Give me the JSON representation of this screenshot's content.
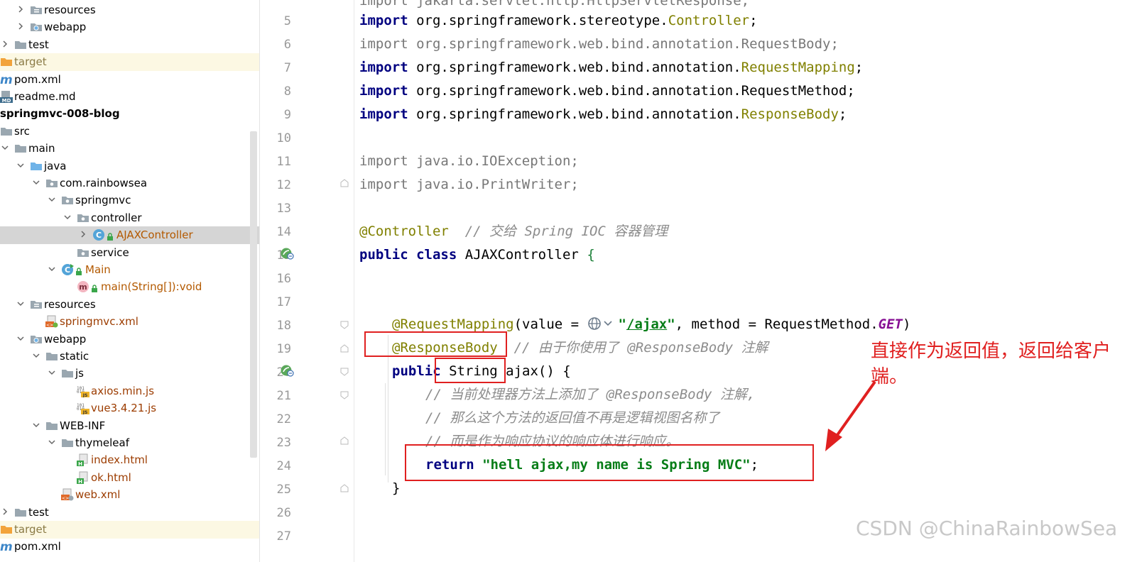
{
  "tree": {
    "items": [
      {
        "label": "resources",
        "indent": 1,
        "arrow": "right",
        "icon": "resources-folder-icon",
        "style": ""
      },
      {
        "label": "webapp",
        "indent": 1,
        "arrow": "right",
        "icon": "web-folder-icon",
        "style": ""
      },
      {
        "label": "test",
        "indent": 0,
        "arrow": "right",
        "icon": "folder-icon",
        "style": ""
      },
      {
        "label": "target",
        "indent": 0,
        "arrow": "",
        "icon": "orange-folder-icon",
        "style": "muted",
        "row": "hl-yellow"
      },
      {
        "label": "pom.xml",
        "indent": 0,
        "arrow": "",
        "icon": "maven-icon",
        "style": ""
      },
      {
        "label": "readme.md",
        "indent": 0,
        "arrow": "",
        "icon": "markdown-icon",
        "style": ""
      },
      {
        "label": "springmvc-008-blog",
        "indent": 0,
        "arrow": "",
        "icon": "",
        "style": "bold"
      },
      {
        "label": "src",
        "indent": 0,
        "arrow": "",
        "icon": "folder-icon",
        "style": ""
      },
      {
        "label": "main",
        "indent": 0,
        "arrow": "down",
        "icon": "folder-icon",
        "style": ""
      },
      {
        "label": "java",
        "indent": 1,
        "arrow": "down",
        "icon": "source-folder-icon",
        "style": ""
      },
      {
        "label": "com.rainbowsea",
        "indent": 2,
        "arrow": "down",
        "icon": "package-icon",
        "style": ""
      },
      {
        "label": "springmvc",
        "indent": 3,
        "arrow": "down",
        "icon": "package-icon",
        "style": ""
      },
      {
        "label": "controller",
        "indent": 4,
        "arrow": "down",
        "icon": "package-icon",
        "style": ""
      },
      {
        "label": "AJAXController",
        "indent": 5,
        "arrow": "right",
        "icon": "class-icon",
        "style": "orange",
        "row": "hl-gray"
      },
      {
        "label": "service",
        "indent": 4,
        "arrow": "",
        "icon": "package-icon",
        "style": ""
      },
      {
        "label": "Main",
        "indent": 3,
        "arrow": "down",
        "icon": "main-class-icon",
        "style": "orange"
      },
      {
        "label": "main(String[]):void",
        "indent": 4,
        "arrow": "",
        "icon": "method-icon",
        "style": "orange"
      },
      {
        "label": "resources",
        "indent": 1,
        "arrow": "down",
        "icon": "resources-folder-icon",
        "style": ""
      },
      {
        "label": "springmvc.xml",
        "indent": 2,
        "arrow": "",
        "icon": "spring-xml-icon",
        "style": "brown"
      },
      {
        "label": "webapp",
        "indent": 1,
        "arrow": "down",
        "icon": "web-folder-icon",
        "style": ""
      },
      {
        "label": "static",
        "indent": 2,
        "arrow": "down",
        "icon": "folder-icon",
        "style": ""
      },
      {
        "label": "js",
        "indent": 3,
        "arrow": "down",
        "icon": "folder-icon",
        "style": ""
      },
      {
        "label": "axios.min.js",
        "indent": 4,
        "arrow": "",
        "icon": "js-file-icon",
        "style": "brown"
      },
      {
        "label": "vue3.4.21.js",
        "indent": 4,
        "arrow": "",
        "icon": "js-file-icon",
        "style": "brown"
      },
      {
        "label": "WEB-INF",
        "indent": 2,
        "arrow": "down",
        "icon": "folder-icon",
        "style": ""
      },
      {
        "label": "thymeleaf",
        "indent": 3,
        "arrow": "down",
        "icon": "folder-icon",
        "style": ""
      },
      {
        "label": "index.html",
        "indent": 4,
        "arrow": "",
        "icon": "html-file-icon",
        "style": "brown"
      },
      {
        "label": "ok.html",
        "indent": 4,
        "arrow": "",
        "icon": "html-file-icon",
        "style": "brown"
      },
      {
        "label": "web.xml",
        "indent": 3,
        "arrow": "",
        "icon": "web-xml-icon",
        "style": "brown"
      },
      {
        "label": "test",
        "indent": 0,
        "arrow": "right",
        "icon": "folder-icon",
        "style": ""
      },
      {
        "label": "target",
        "indent": 0,
        "arrow": "",
        "icon": "orange-folder-icon",
        "style": "muted",
        "row": "hl-yellow"
      },
      {
        "label": "pom.xml",
        "indent": 0,
        "arrow": "",
        "icon": "maven-icon",
        "style": ""
      }
    ]
  },
  "editor": {
    "line_numbers": [
      "5",
      "6",
      "7",
      "8",
      "9",
      "10",
      "11",
      "12",
      "13",
      "14",
      "15",
      "16",
      "17",
      "18",
      "19",
      "20",
      "21",
      "22",
      "23",
      "24",
      "25",
      "26",
      "27"
    ],
    "code": {
      "l4": "import jakarta.servlet.http.HttpServletResponse;",
      "l5_kw": "import",
      "l5_pkg": " org.springframework.stereotype.",
      "l5_cls": "Controller",
      "l6": "import org.springframework.web.bind.annotation.RequestBody;",
      "l7_kw": "import",
      "l7_pkg": " org.springframework.web.bind.annotation.",
      "l7_cls": "RequestMapping",
      "l8_kw": "import",
      "l8_rest": " org.springframework.web.bind.annotation.RequestMethod;",
      "l9_kw": "import",
      "l9_pkg": " org.springframework.web.bind.annotation.",
      "l9_cls": "ResponseBody",
      "l11": "import java.io.IOException;",
      "l12": "import java.io.PrintWriter;",
      "l14_ann": "@Controller",
      "l14_cm": "  // 交给 Spring IOC 容器管理",
      "l15_kw": "public class",
      "l15_name": " AJAXController ",
      "l15_brace": "{",
      "l18_ann": "@RequestMapping",
      "l18_a": "(value = ",
      "l18_url": "/ajax",
      "l18_b": ", method = RequestMethod.",
      "l18_get": "GET",
      "l18_c": ")",
      "l19_ann": "@ResponseBody",
      "l19_cm": "  // 由于你使用了 @ResponseBody 注解",
      "l20_kw": "public",
      "l20_rest": " String ajax() {",
      "l21_cm": "// 当前处理器方法上添加了 @ResponseBody 注解,",
      "l22_cm": "// 那么这个方法的返回值不再是逻辑视图名称了",
      "l23_cm": "// 而是作为响应协议的响应体进行响应。",
      "l24_kw": "return",
      "l24_str": "\"hell ajax,my name is Spring MVC\"",
      "l24_end": ";",
      "l25": "}"
    }
  },
  "annotation": {
    "note": "直接作为返回值，返回给客户端。",
    "color": "#e02020"
  },
  "watermark": "CSDN @ChinaRainbowSea"
}
